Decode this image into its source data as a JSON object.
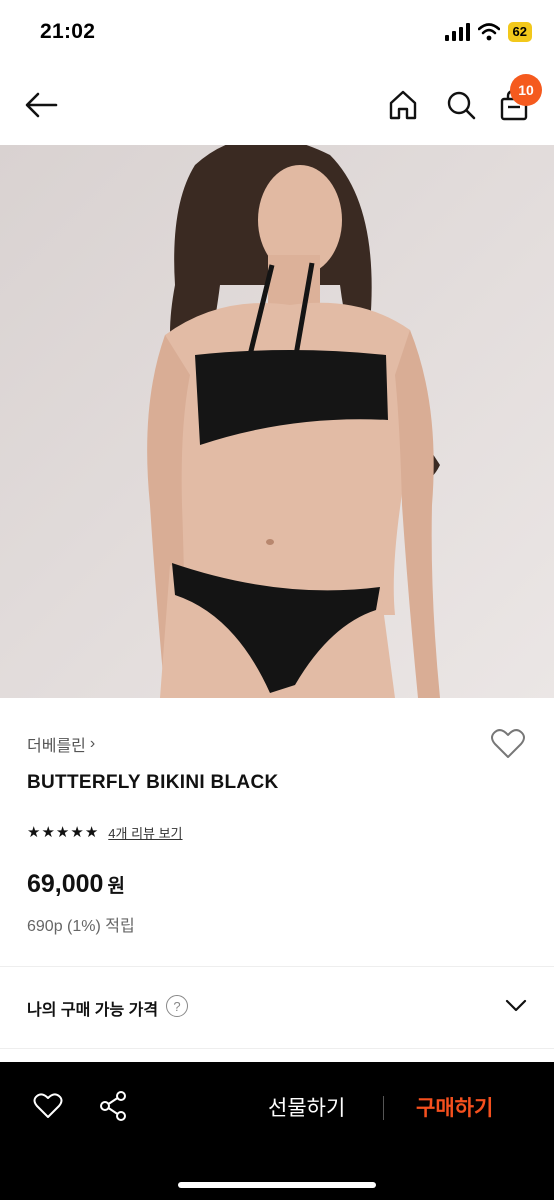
{
  "status_bar": {
    "time": "21:02",
    "battery": "62",
    "icons": [
      "signal-icon",
      "wifi-icon",
      "battery-icon"
    ]
  },
  "nav": {
    "cart_badge": "10",
    "icons": [
      "back-arrow-icon",
      "home-icon",
      "search-icon",
      "shopping-bag-icon"
    ]
  },
  "product": {
    "brand": "더베를린",
    "brand_chevron": "›",
    "name": "BUTTERFLY BIKINI BLACK",
    "rating_stars": 5,
    "review_link": "4개 리뷰 보기",
    "price": "69,000",
    "currency": "원",
    "points": "690p (1%) 적립"
  },
  "price_option": {
    "label": "나의 구매 가능 가격",
    "help": "?"
  },
  "bottom_bar": {
    "gift_label": "선물하기",
    "buy_label": "구매하기"
  },
  "colors": {
    "accent": "#f5501e",
    "badge": "#f55a1e",
    "battery": "#f2c81b",
    "bottom_bar_bg": "#000000"
  }
}
